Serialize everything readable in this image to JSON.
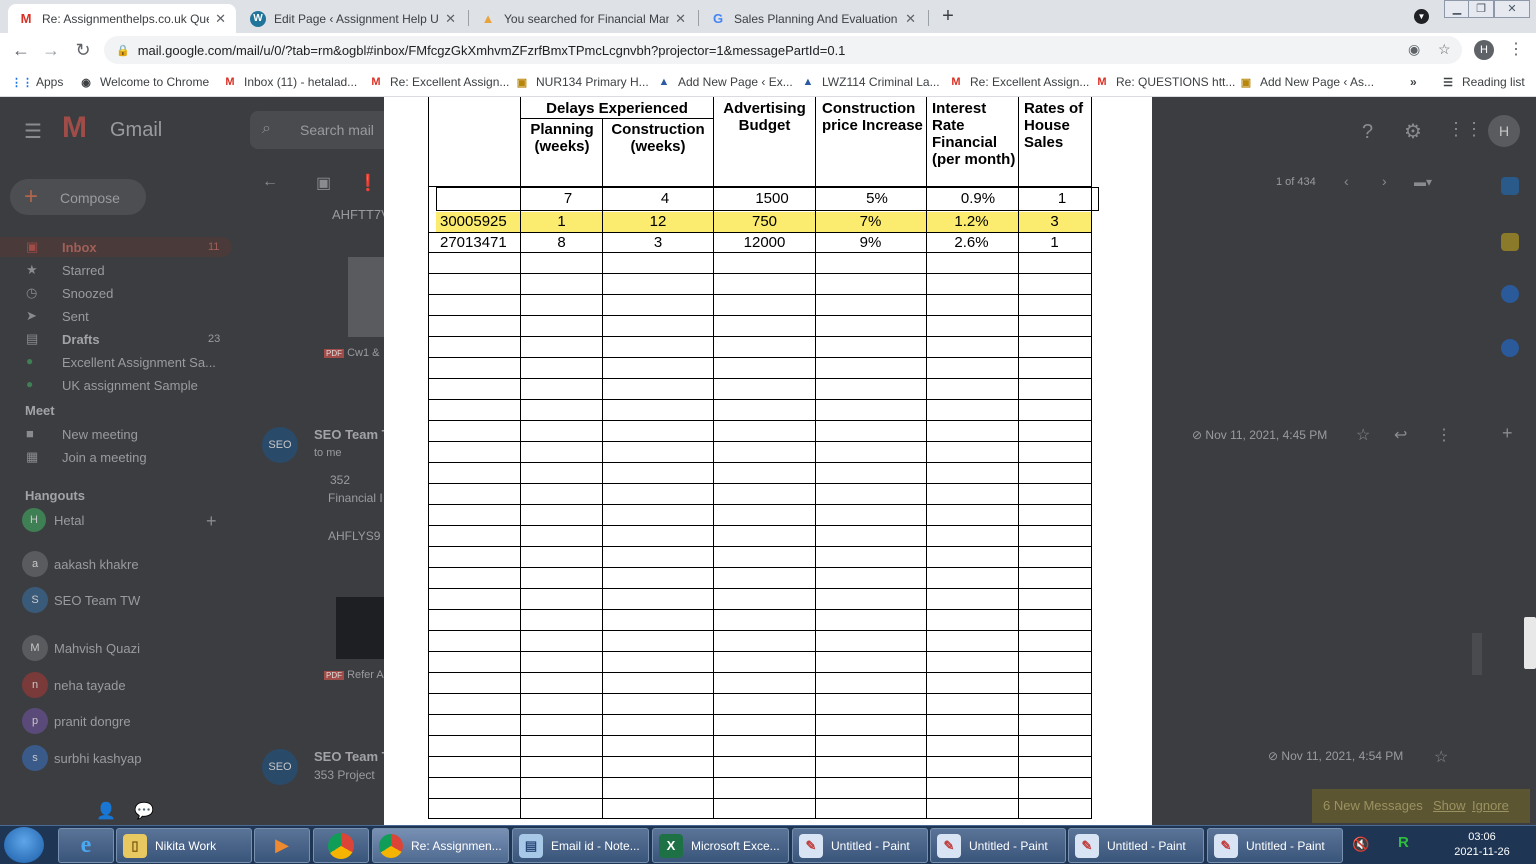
{
  "browser": {
    "tabs": [
      {
        "title": "Re: Assignmenthelps.co.uk Quest",
        "icon": "gmail-icon",
        "active": true
      },
      {
        "title": "Edit Page ‹ Assignment Help UK -",
        "icon": "wordpress-icon",
        "active": false
      },
      {
        "title": "You searched for Financial Manag",
        "icon": "site-icon",
        "active": false
      },
      {
        "title": "Sales Planning And Evaluation - C",
        "icon": "google-icon",
        "active": false
      }
    ],
    "url": "mail.google.com/mail/u/0/?tab=rm&ogbl#inbox/FMfcgzGkXmhvmZFzrfBmxTPmcLcgnvbh?projector=1&messagePartId=0.1",
    "profile_initial": "H",
    "bookmarks": [
      {
        "label": "Apps"
      },
      {
        "label": "Welcome to Chrome"
      },
      {
        "label": "Inbox (11) - hetalad..."
      },
      {
        "label": "Re: Excellent Assign..."
      },
      {
        "label": "NUR134 Primary H..."
      },
      {
        "label": "Add New Page ‹ Ex..."
      },
      {
        "label": "LWZ114 Criminal La..."
      },
      {
        "label": "Re: Excellent Assign..."
      },
      {
        "label": "Re: QUESTIONS htt..."
      },
      {
        "label": "Add New Page ‹ As..."
      }
    ],
    "bookmarks_overflow": "»",
    "reading_list": "Reading list"
  },
  "gmail": {
    "logo_text": "Gmail",
    "search_placeholder": "Search mail",
    "compose": "Compose",
    "nav": [
      {
        "label": "Inbox",
        "count": "11"
      },
      {
        "label": "Starred",
        "count": ""
      },
      {
        "label": "Snoozed",
        "count": ""
      },
      {
        "label": "Sent",
        "count": ""
      },
      {
        "label": "Drafts",
        "count": "23"
      },
      {
        "label": "Excellent Assignment Sa...",
        "count": ""
      },
      {
        "label": "UK assignment Sample",
        "count": ""
      }
    ],
    "meet_header": "Meet",
    "meet_items": [
      "New meeting",
      "Join a meeting"
    ],
    "hangouts_header": "Hangouts",
    "hangouts_user": "Hetal",
    "contacts": [
      "aakash khakre",
      "SEO Team TW",
      "Mahvish Quazi",
      "neha tayade",
      "pranit dongre",
      "surbhi kashyap"
    ],
    "pager": "1 of 434",
    "thread_subject_snippet": "AHFTT7V",
    "messages": [
      {
        "sender": "SEO Team T",
        "to": "to me",
        "snippet1": "352",
        "snippet2": "Financial I",
        "snippet3": "AHFLYS9",
        "date": "Nov 11, 2021, 4:45 PM"
      },
      {
        "sender": "SEO Team T",
        "snippet1": "353 Project",
        "date": "Nov 11, 2021, 4:54 PM"
      }
    ],
    "attachments": [
      "Cw1 &",
      "Refer A"
    ],
    "notification": {
      "text": "6 New Messages",
      "show": "Show",
      "ignore": "Ignore"
    }
  },
  "document": {
    "headers": {
      "delays": "Delays Experienced",
      "planning": "Planning (weeks)",
      "construction": "Construction (weeks)",
      "advertising": "Advertising Budget",
      "price": "Construction price Increase",
      "interest": "Interest Rate Financial (per month)",
      "rates": "Rates of House Sales"
    },
    "base_row": [
      "",
      "7",
      "4",
      "1500",
      "5%",
      "0.9%",
      "1"
    ],
    "rows": [
      [
        "30005925",
        "1",
        "12",
        "750",
        "7%",
        "1.2%",
        "3"
      ],
      [
        "27013471",
        "8",
        "3",
        "12000",
        "9%",
        "2.6%",
        "1"
      ]
    ],
    "highlight_color": "#fbeb6e"
  },
  "taskbar": {
    "items": [
      {
        "label": "Nikita Work"
      },
      {
        "label": "Re: Assignmen..."
      },
      {
        "label": "Email id - Note..."
      },
      {
        "label": "Microsoft Exce..."
      },
      {
        "label": "Untitled - Paint"
      },
      {
        "label": "Untitled - Paint"
      },
      {
        "label": "Untitled - Paint"
      },
      {
        "label": "Untitled - Paint"
      }
    ],
    "time": "03:06",
    "date": "2021-11-26"
  }
}
